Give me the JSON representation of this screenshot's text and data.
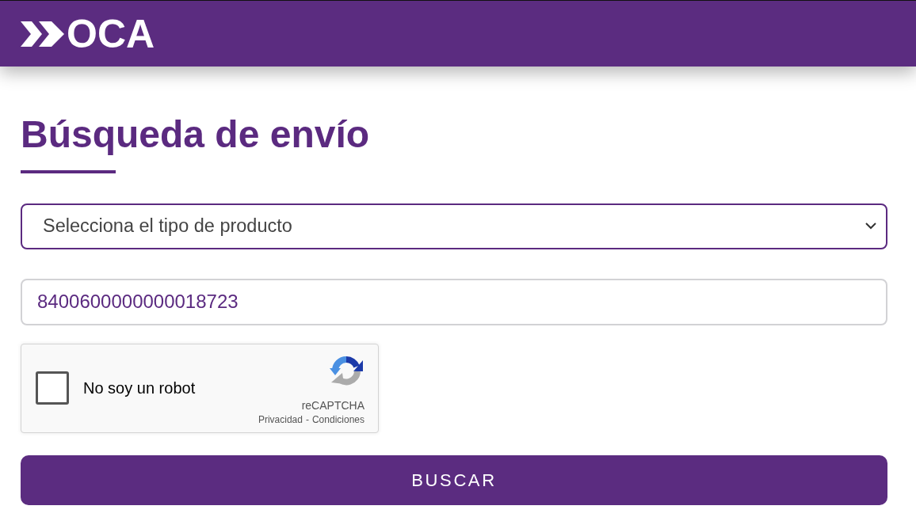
{
  "header": {
    "logo_text": "OCA"
  },
  "heading": "Búsqueda de envío",
  "product_select": {
    "placeholder": "Selecciona el tipo de producto"
  },
  "tracking_field": {
    "value": "8400600000000018723"
  },
  "captcha": {
    "checked": false,
    "label": "No soy un robot",
    "brand": "reCAPTCHA",
    "links": [
      {
        "label": "Privacidad"
      },
      {
        "label": "Condiciones"
      }
    ],
    "separator": "-"
  },
  "search_button": {
    "label": "BUSCAR"
  }
}
